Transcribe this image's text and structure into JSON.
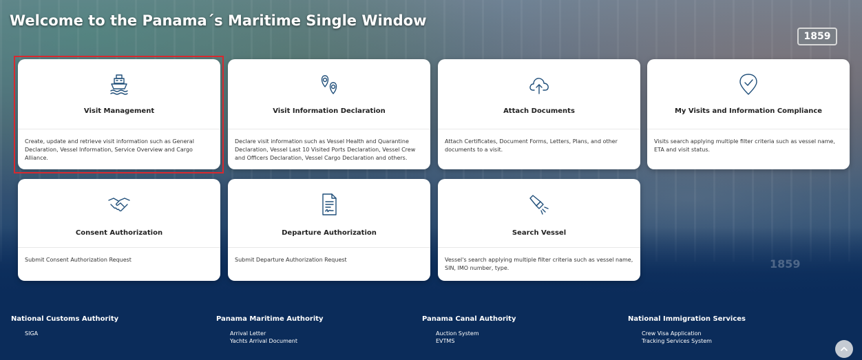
{
  "page": {
    "title": "Welcome to the Panama´s Maritime Single Window",
    "background_badge": "1859"
  },
  "colors": {
    "accent_selection": "#d8292f",
    "footer_bg": "#0b2c5a",
    "card_bg": "#ffffff"
  },
  "cards": [
    {
      "icon": "ship-icon",
      "title": "Visit Management",
      "description": "Create, update and retrieve visit information such as General Declaration, Vessel Information, Service Overview and Cargo Alliance.",
      "selected": true
    },
    {
      "icon": "map-pins-icon",
      "title": "Visit Information Declaration",
      "description": "Declare visit information such as Vessel Health and Quarantine Declaration, Vessel Last 10 Visited Ports Declaration, Vessel Crew and Officers Declaration, Vessel Cargo Declaration and others."
    },
    {
      "icon": "cloud-upload-icon",
      "title": "Attach Documents",
      "description": "Attach Certificates, Document Forms, Letters, Plans, and other documents to a visit."
    },
    {
      "icon": "location-check-icon",
      "title": "My Visits and Information Compliance",
      "description": "Visits search applying multiple filter criteria such as vessel name, ETA and visit status."
    },
    {
      "icon": "handshake-icon",
      "title": "Consent Authorization",
      "description": "Submit Consent Authorization Request"
    },
    {
      "icon": "signed-document-icon",
      "title": "Departure Authorization",
      "description": "Submit Departure Authorization Request"
    },
    {
      "icon": "flashlight-icon",
      "title": "Search Vessel",
      "description": "Vessel's search applying multiple filter criteria such as vessel name, SIN, IMO number, type."
    }
  ],
  "footer": {
    "columns": [
      {
        "heading": "National Customs Authority",
        "links": [
          "SIGA"
        ]
      },
      {
        "heading": "Panama Maritime Authority",
        "links": [
          "Arrival Letter",
          "Yachts Arrival Document"
        ]
      },
      {
        "heading": "Panama Canal Authority",
        "links": [
          "Auction System",
          "EVTMS"
        ]
      },
      {
        "heading": "National Immigration Services",
        "links": [
          "Crew Visa Application",
          "Tracking Services System"
        ]
      }
    ]
  },
  "scroll_top": {
    "icon": "chevron-up-icon"
  }
}
